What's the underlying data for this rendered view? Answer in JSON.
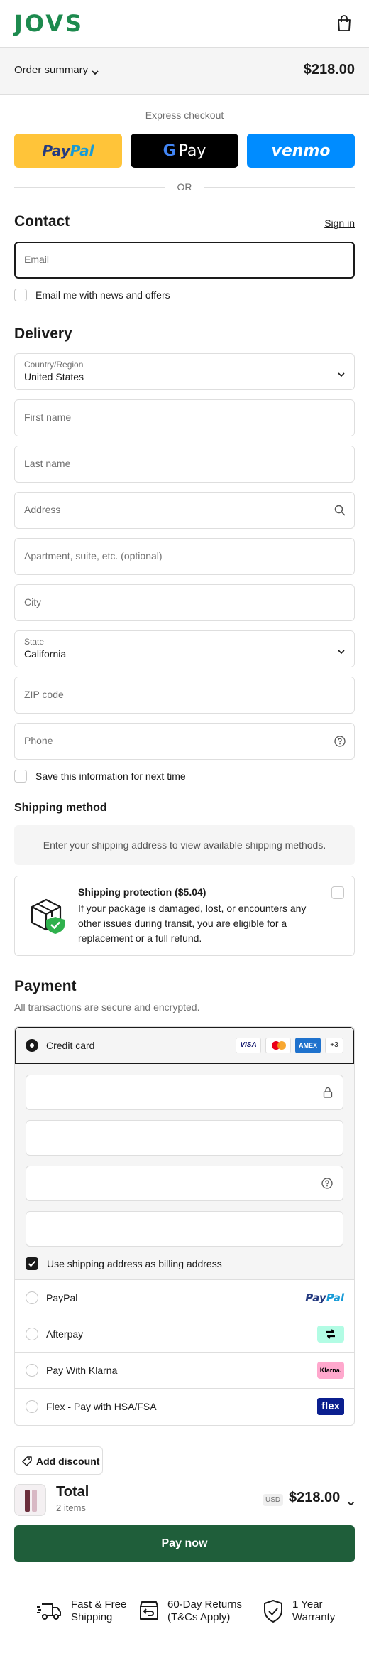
{
  "header": {
    "logo": "JOVS"
  },
  "order_summary": {
    "label": "Order summary",
    "total": "$218.00"
  },
  "express": {
    "label": "Express checkout",
    "paypal": "PayPal",
    "gpay": "Pay",
    "venmo": "venmo",
    "or": "OR"
  },
  "contact": {
    "title": "Contact",
    "sign_in": "Sign in",
    "email_placeholder": "Email",
    "news_label": "Email me with news and offers"
  },
  "delivery": {
    "title": "Delivery",
    "country_label": "Country/Region",
    "country_value": "United States",
    "first_name": "First name",
    "last_name": "Last name",
    "address": "Address",
    "apartment": "Apartment, suite, etc. (optional)",
    "city": "City",
    "state_label": "State",
    "state_value": "California",
    "zip": "ZIP code",
    "phone": "Phone",
    "save_label": "Save this information for next time"
  },
  "shipping": {
    "title": "Shipping method",
    "empty": "Enter your shipping address to view available shipping methods."
  },
  "protection": {
    "title": "Shipping protection ($5.04)",
    "description": "If your package is damaged, lost, or encounters any other issues during transit, you are eligible for a replacement or a full refund."
  },
  "payment": {
    "title": "Payment",
    "subtitle": "All transactions are secure and encrypted.",
    "credit_card": "Credit card",
    "cards": [
      "VISA",
      "AMEX"
    ],
    "more_cards": "+3",
    "billing_label": "Use shipping address as billing address",
    "options": [
      {
        "label": "PayPal",
        "logo": "PayPal"
      },
      {
        "label": "Afterpay",
        "logo": "afterpay-icon"
      },
      {
        "label": "Pay With Klarna",
        "logo": "Klarna."
      },
      {
        "label": "Flex - Pay with HSA/FSA",
        "logo": "flex"
      }
    ]
  },
  "discount": {
    "label": "Add discount"
  },
  "total": {
    "label": "Total",
    "items": "2 items",
    "currency": "USD",
    "amount": "$218.00"
  },
  "pay_now": "Pay now",
  "features": [
    {
      "line1": "Fast & Free",
      "line2": "Shipping"
    },
    {
      "line1": "60-Day Returns",
      "line2": "(T&Cs Apply)"
    },
    {
      "line1": "1 Year",
      "line2": "Warranty"
    }
  ],
  "colors": {
    "brand": "#1d8a4e",
    "pay_button": "#1f5e3a",
    "paypal_yellow": "#ffc439",
    "venmo_blue": "#008cff"
  }
}
